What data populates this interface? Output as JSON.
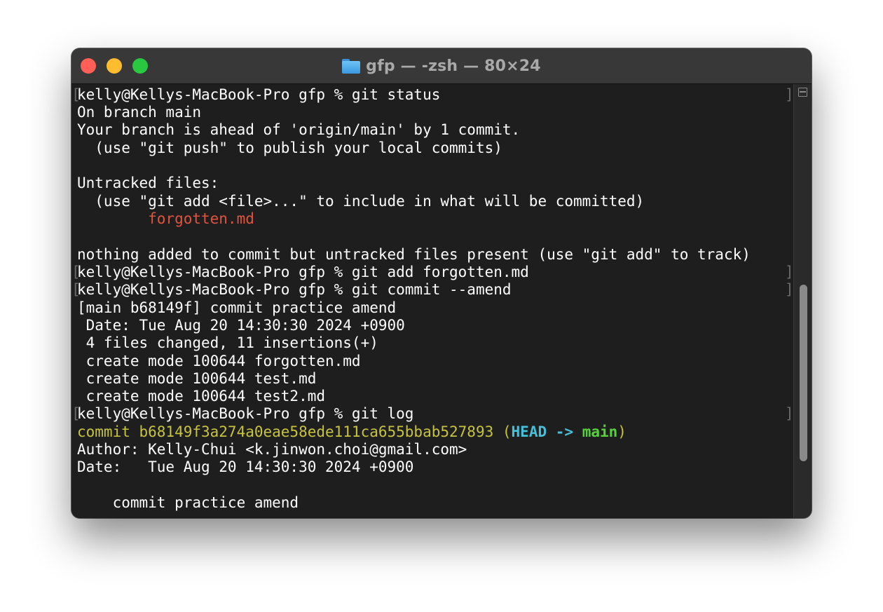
{
  "window": {
    "title": "gfp — -zsh — 80×24"
  },
  "terminal": {
    "lines": [
      "kelly@Kellys-MacBook-Pro gfp % git status",
      "On branch main",
      "Your branch is ahead of 'origin/main' by 1 commit.",
      "  (use \"git push\" to publish your local commits)",
      "",
      "Untracked files:",
      "  (use \"git add <file>...\" to include in what will be committed)",
      "        forgotten.md",
      "",
      "nothing added to commit but untracked files present (use \"git add\" to track)",
      "kelly@Kellys-MacBook-Pro gfp % git add forgotten.md",
      "kelly@Kellys-MacBook-Pro gfp % git commit --amend",
      "[main b68149f] commit practice amend",
      " Date: Tue Aug 20 14:30:30 2024 +0900",
      " 4 files changed, 11 insertions(+)",
      " create mode 100644 forgotten.md",
      " create mode 100644 test.md",
      " create mode 100644 test2.md",
      "kelly@Kellys-MacBook-Pro gfp % git log",
      "",
      "Author: Kelly-Chui <k.jinwon.choi@gmail.com>",
      "Date:   Tue Aug 20 14:30:30 2024 +0900",
      "",
      "    commit practice amend"
    ],
    "log_commit": {
      "prefix": "commit b68149f3a274a0eae58ede111ca655bbab527893 ",
      "open_paren": "(",
      "head": "HEAD -> ",
      "branch": "main",
      "close_paren": ")"
    },
    "mark_open": "[",
    "mark_close": "]"
  },
  "colors": {
    "close": "#ff5f57",
    "minimize": "#febc2e",
    "maximize": "#28c840",
    "untracked_file": "#e0533d",
    "commit_hash": "#c7c43a",
    "head_ref": "#46c0d8",
    "branch_ref": "#56d23b"
  },
  "icons": {
    "folder": "folder-icon",
    "scroll_toggle": "split-view-icon"
  }
}
